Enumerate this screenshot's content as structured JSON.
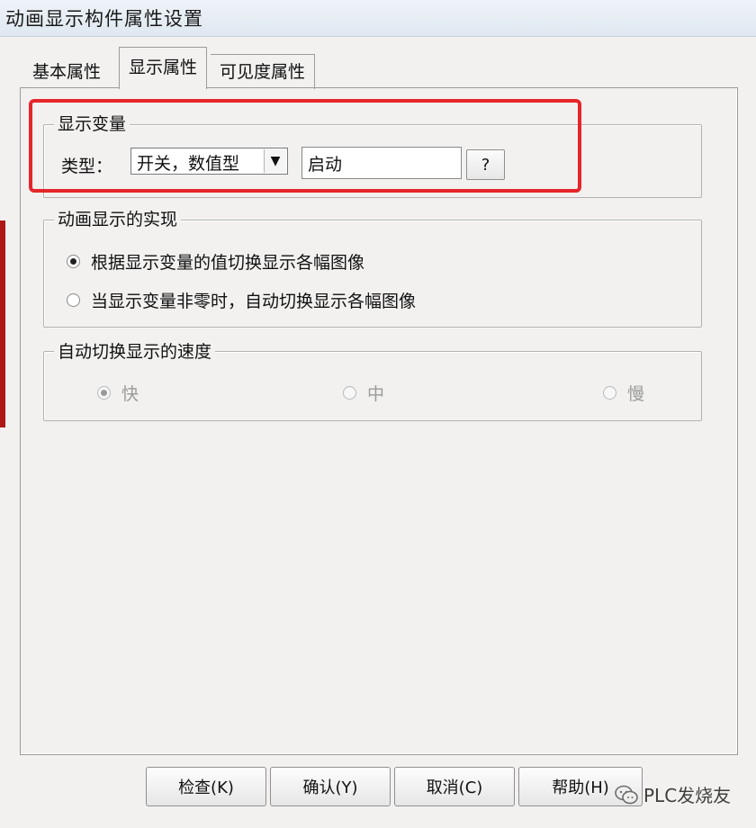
{
  "window": {
    "title": "动画显示构件属性设置"
  },
  "tabs": [
    {
      "label": "基本属性",
      "active": false
    },
    {
      "label": "显示属性",
      "active": true
    },
    {
      "label": "可见度属性",
      "active": false
    }
  ],
  "display_variable": {
    "legend": "显示变量",
    "type_label": "类型：",
    "type_value": "开关，数值型",
    "variable_value": "启动",
    "help_button": "?"
  },
  "realization": {
    "legend": "动画显示的实现",
    "options": [
      {
        "label": "根据显示变量的值切换显示各幅图像",
        "checked": true
      },
      {
        "label": "当显示变量非零时，自动切换显示各幅图像",
        "checked": false
      }
    ]
  },
  "speed": {
    "legend": "自动切换显示的速度",
    "disabled": true,
    "options": [
      {
        "label": "快",
        "checked": true
      },
      {
        "label": "中",
        "checked": false
      },
      {
        "label": "慢",
        "checked": false
      }
    ]
  },
  "buttons": {
    "check": "检查(K)",
    "confirm": "确认(Y)",
    "cancel": "取消(C)",
    "help": "帮助(H)"
  },
  "watermark": {
    "text": "PLC发烧友"
  },
  "colors": {
    "highlight": "#e5262a",
    "background": "#f2f1f0"
  }
}
